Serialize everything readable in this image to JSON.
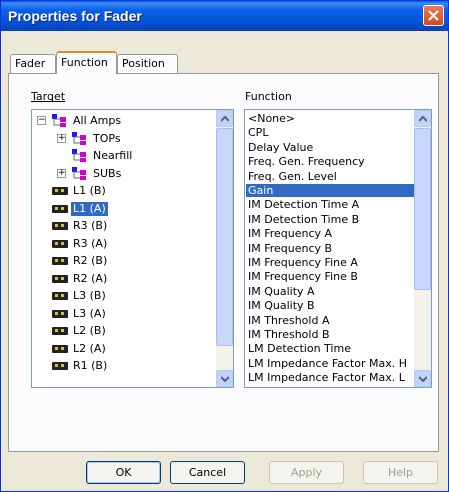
{
  "window": {
    "title": "Properties for Fader"
  },
  "tabs": [
    "Fader",
    "Function",
    "Position"
  ],
  "target": {
    "label": "Target",
    "tree": [
      {
        "label": "All Amps",
        "level": 0,
        "expanded": true,
        "kind": "group"
      },
      {
        "label": "TOPs",
        "level": 1,
        "expander": "+",
        "kind": "group"
      },
      {
        "label": "Nearfill",
        "level": 1,
        "expander": "",
        "kind": "group"
      },
      {
        "label": "SUBs",
        "level": 1,
        "expander": "+",
        "kind": "group"
      },
      {
        "label": "L1 (B)",
        "level": 0,
        "kind": "amp"
      },
      {
        "label": "L1 (A)",
        "level": 0,
        "kind": "amp",
        "selected": true
      },
      {
        "label": "R3 (B)",
        "level": 0,
        "kind": "amp"
      },
      {
        "label": "R3 (A)",
        "level": 0,
        "kind": "amp"
      },
      {
        "label": "R2 (B)",
        "level": 0,
        "kind": "amp"
      },
      {
        "label": "R2 (A)",
        "level": 0,
        "kind": "amp"
      },
      {
        "label": "L3 (B)",
        "level": 0,
        "kind": "amp"
      },
      {
        "label": "L3 (A)",
        "level": 0,
        "kind": "amp"
      },
      {
        "label": "L2 (B)",
        "level": 0,
        "kind": "amp"
      },
      {
        "label": "L2 (A)",
        "level": 0,
        "kind": "amp"
      },
      {
        "label": "R1 (B)",
        "level": 0,
        "kind": "amp"
      }
    ]
  },
  "function": {
    "label": "Function",
    "items": [
      "<None>",
      "CPL",
      "Delay Value",
      "Freq. Gen. Frequency",
      "Freq. Gen. Level",
      "Gain",
      "IM Detection Time A",
      "IM Detection Time B",
      "IM Frequency A",
      "IM Frequency B",
      "IM Frequency Fine A",
      "IM Frequency Fine B",
      "IM Quality A",
      "IM Quality B",
      "IM Threshold A",
      "IM Threshold B",
      "LM Detection Time",
      "LM Impedance Factor Max. H",
      "LM Impedance Factor Max. L"
    ],
    "selected": "Gain"
  },
  "buttons": {
    "ok": "OK",
    "cancel": "Cancel",
    "apply": "Apply",
    "help": "Help"
  },
  "colors": {
    "title_bar": "#0a5fe8",
    "selection": "#316ac5",
    "close": "#d34a1f"
  },
  "icons": {
    "close": "close-icon",
    "group": "group-node-icon",
    "amp": "amplifier-icon"
  }
}
